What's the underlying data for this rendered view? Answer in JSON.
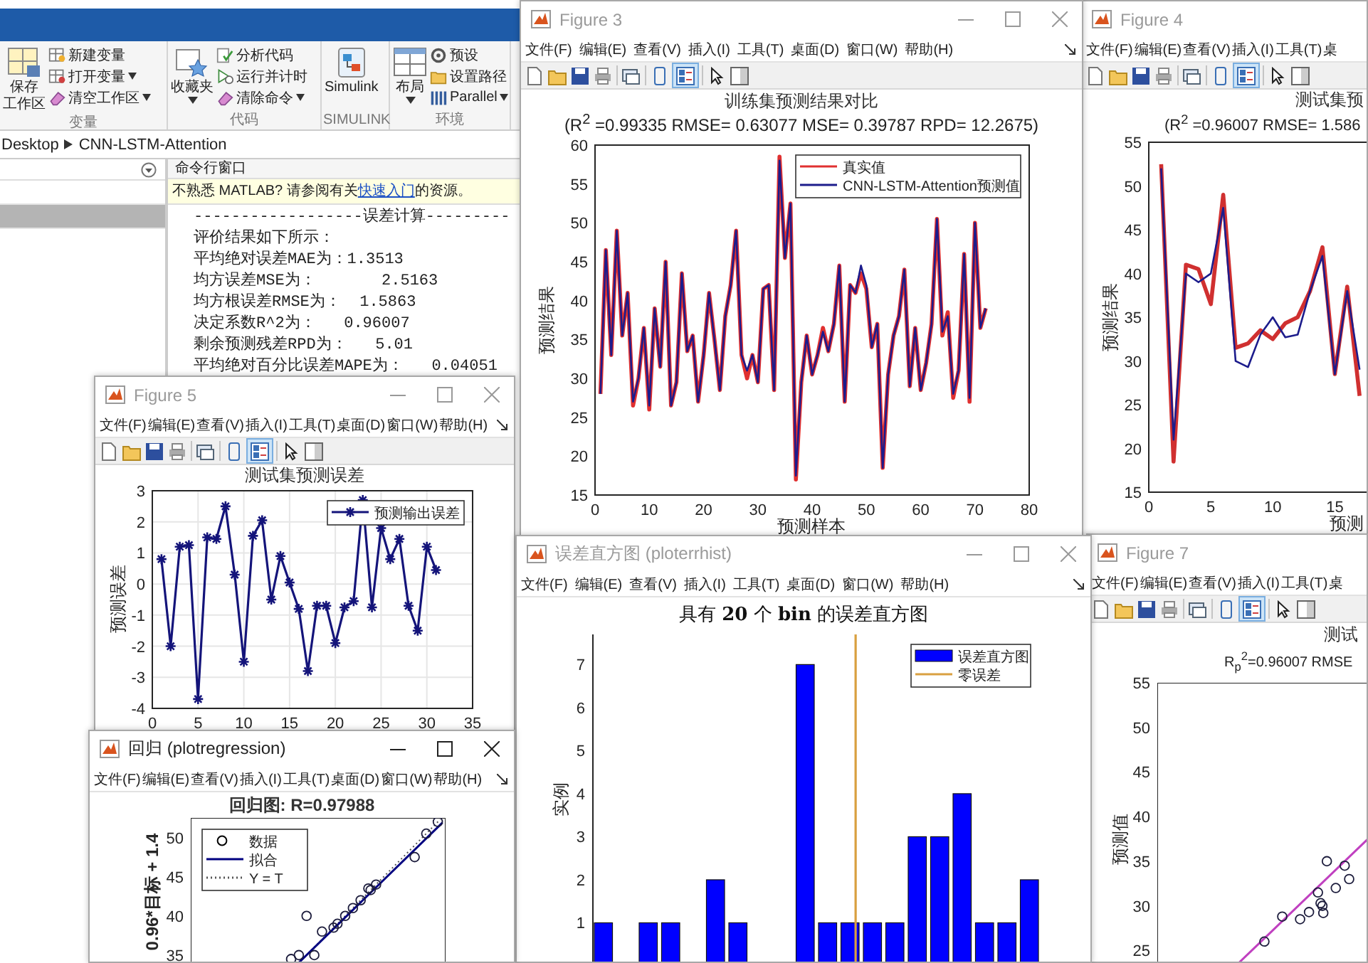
{
  "matlab": {
    "toolstrip": [
      {
        "label": "变量",
        "big": {
          "label_lines": [
            "保存",
            "工作区"
          ],
          "dropdown": false
        },
        "small": [
          {
            "label": "新建变量",
            "dropdown": false
          },
          {
            "label": "打开变量",
            "dropdown": true
          },
          {
            "label": "清空工作区",
            "dropdown": true
          }
        ]
      },
      {
        "label": "代码",
        "big": {
          "label_lines": [
            "收藏夹"
          ],
          "dropdown": true
        },
        "small": [
          {
            "label": "分析代码",
            "dropdown": false
          },
          {
            "label": "运行并计时",
            "dropdown": false
          },
          {
            "label": "清除命令",
            "dropdown": true
          }
        ]
      },
      {
        "label": "SIMULINK",
        "big": {
          "label_lines": [
            "Simulink"
          ],
          "dropdown": false
        }
      },
      {
        "label": "环境",
        "big": {
          "label_lines": [
            "布局"
          ],
          "dropdown": true
        },
        "small": [
          {
            "label": "预设",
            "dropdown": false
          },
          {
            "label": "设置路径",
            "dropdown": false
          },
          {
            "label": "Parallel",
            "dropdown": true
          }
        ]
      }
    ],
    "breadcrumb": [
      "Desktop",
      "CNN-LSTM-Attention"
    ],
    "folder_panel": {
      "rows": [
        {
          "selected": false
        },
        {
          "selected": true
        }
      ]
    },
    "command_window": {
      "title": "命令行窗口",
      "notice": {
        "before": "不熟悉 MATLAB? 请参阅有关",
        "link": "快速入门",
        "after": "的资源。"
      },
      "lines": [
        "------------------误差计算---------",
        "评价结果如下所示：",
        "平均绝对误差MAE为：1.3513",
        "均方误差MSE为：       2.5163",
        "均方根误差RMSE为：  1.5863",
        "决定系数R^2为：   0.96007",
        "剩余预测残差RPD为：   5.01",
        "平均绝对百分比误差MAPE为：   0.04051"
      ]
    }
  },
  "figures": [
    {
      "title": "Figure 3",
      "active": false,
      "menu": [
        "文件(F)",
        "编辑(E)",
        "查看(V)",
        "插入(I)",
        "工具(T)",
        "桌面(D)",
        "窗口(W)",
        "帮助(H)"
      ],
      "toolbar": {
        "plot_tools_on": true
      },
      "bold_title": false,
      "subtitle": "(R$^{2}$ =0.99335 RMSE= 0.63077 MSE= 0.39787 RPD= 12.2675)",
      "chart_data": {
        "type": "line",
        "title": "训练集预测结果对比",
        "xlabel": "预测样本",
        "ylabel": "预测结果",
        "legend": "upper right",
        "x": [
          1,
          2,
          3,
          4,
          5,
          6,
          7,
          8,
          9,
          10,
          11,
          12,
          13,
          14,
          15,
          16,
          17,
          18,
          19,
          20,
          21,
          22,
          23,
          24,
          25,
          26,
          27,
          28,
          29,
          30,
          31,
          32,
          33,
          34,
          35,
          36,
          37,
          38,
          39,
          40,
          41,
          42,
          43,
          44,
          45,
          46,
          47,
          48,
          49,
          50,
          51,
          52,
          53,
          54,
          55,
          56,
          57,
          58,
          59,
          60,
          61,
          62,
          63,
          64,
          65,
          66,
          67,
          68,
          69,
          70,
          71,
          72
        ],
        "series": [
          {
            "name": "真实值",
            "color": "#e03030",
            "values": [
              28,
              46.5,
              33,
              49,
              35.5,
              41,
              26.5,
              30,
              36.5,
              26,
              39,
              31.5,
              45,
              26.5,
              29.5,
              43.5,
              33.5,
              35.5,
              27,
              33,
              41,
              35,
              28.5,
              38,
              42,
              49,
              33,
              30,
              33,
              29.5,
              41.5,
              42,
              28.5,
              58.5,
              45.5,
              52.5,
              17,
              29.5,
              35.5,
              30.5,
              33,
              36.5,
              33.5,
              37,
              44.5,
              27,
              42,
              41,
              43.5,
              41.5,
              34,
              37,
              18.5,
              30.5,
              35.5,
              38,
              44,
              29,
              36.5,
              28.5,
              32,
              37,
              50.5,
              35.5,
              38.5,
              27.5,
              31,
              46,
              27,
              50,
              36.5,
              39
            ]
          },
          {
            "name": "CNN-LSTM-Attention预测值",
            "color": "#1c1c8c",
            "values": [
              28,
              46.5,
              33,
              49,
              35.5,
              41,
              27,
              30,
              36.5,
              26.5,
              39,
              31.5,
              45,
              26.5,
              29.5,
              43.5,
              33.5,
              35.5,
              27,
              33,
              41,
              35,
              28.5,
              38,
              42,
              49,
              33,
              31,
              33,
              29.5,
              41.5,
              42,
              28.5,
              58,
              45.5,
              52.5,
              17.5,
              29.5,
              35.5,
              30.5,
              33,
              36,
              33.5,
              37,
              44.5,
              27,
              42,
              41,
              44.5,
              42,
              34,
              37,
              18.5,
              30.5,
              35.5,
              38,
              44,
              29,
              36.5,
              28.5,
              32,
              37,
              50.5,
              36,
              38,
              28,
              31,
              46,
              27.5,
              50,
              36.5,
              39
            ]
          }
        ],
        "xlim": [
          0,
          80
        ],
        "ylim": [
          15,
          60
        ],
        "xticks": [
          0,
          10,
          20,
          30,
          40,
          50,
          60,
          70,
          80
        ],
        "yticks": [
          15,
          20,
          25,
          30,
          35,
          40,
          45,
          50,
          55,
          60
        ]
      }
    },
    {
      "title": "Figure 4",
      "active": false,
      "menu": [
        "文件(F)",
        "编辑(E)",
        "查看(V)",
        "插入(I)",
        "工具(T)",
        "桌"
      ],
      "toolbar": {
        "plot_tools_on": true
      },
      "bold_title": false,
      "subtitle": "(R$^{2}$ =0.96007 RMSE= 1.586",
      "chart_data": {
        "type": "line",
        "title": "测试集预",
        "xlabel": "预测",
        "ylabel": "预测结果",
        "x": [
          1,
          2,
          3,
          4,
          5,
          6,
          7,
          8,
          9,
          10,
          11,
          12,
          13,
          14,
          15,
          16,
          17
        ],
        "series": [
          {
            "color": "#d03030",
            "values": [
              52.5,
              18.5,
              41,
              40.5,
              36.5,
              49,
              31.5,
              32,
              33.5,
              32.5,
              34.3,
              35,
              38,
              43,
              28.5,
              38.5,
              26
            ]
          },
          {
            "color": "#1c1c8c",
            "values": [
              52,
              21,
              40,
              39,
              40,
              47.5,
              30,
              29.3,
              33,
              35,
              32.7,
              33,
              38,
              42,
              28.5,
              38,
              29
            ]
          }
        ],
        "xlim": [
          0,
          35
        ],
        "ylim": [
          15,
          55
        ],
        "xticks": [
          0,
          5,
          10,
          15
        ],
        "yticks": [
          15,
          20,
          25,
          30,
          35,
          40,
          45,
          50,
          55
        ]
      }
    },
    {
      "title": "Figure 5",
      "active": false,
      "menu": [
        "文件(F)",
        "编辑(E)",
        "查看(V)",
        "插入(I)",
        "工具(T)",
        "桌面(D)",
        "窗口(W)",
        "帮助(H)"
      ],
      "toolbar": {
        "plot_tools_on": true
      },
      "bold_title": false,
      "chart_data": {
        "type": "line",
        "title": "测试集预测误差",
        "ylabel": "预测误差",
        "legend": "upper right",
        "grid": true,
        "x": [
          1,
          2,
          3,
          4,
          5,
          6,
          7,
          8,
          9,
          10,
          11,
          12,
          13,
          14,
          15,
          16,
          17,
          18,
          19,
          20,
          21,
          22,
          23,
          24,
          25,
          26,
          27,
          28,
          29,
          30,
          31
        ],
        "series": [
          {
            "name": "预测输出误差",
            "color": "#14147a",
            "marker": "cross",
            "values": [
              0.8,
              -2,
              1.2,
              1.25,
              -3.7,
              1.5,
              1.45,
              2.5,
              0.3,
              -2.5,
              1.55,
              2.05,
              -0.5,
              0.9,
              0.05,
              -0.8,
              -2.8,
              -0.7,
              -0.7,
              -1.9,
              -0.75,
              -0.55,
              2.7,
              -0.75,
              1.8,
              0.8,
              1.45,
              -0.7,
              -1.5,
              1.2,
              0.45
            ]
          }
        ],
        "xlim": [
          0,
          35
        ],
        "ylim": [
          -4,
          3
        ],
        "xticks": [
          0,
          5,
          10,
          15,
          20,
          25,
          30,
          35
        ],
        "yticks": [
          -4,
          -3,
          -2,
          -1,
          0,
          1,
          2,
          3
        ]
      }
    },
    {
      "title": "误差直方图 (ploterrhist)",
      "active": false,
      "menu": [
        "文件(F)",
        "编辑(E)",
        "查看(V)",
        "插入(I)",
        "工具(T)",
        "桌面(D)",
        "窗口(W)",
        "帮助(H)"
      ],
      "bold_title": false,
      "chart_picture": {
        "title": "具有 **20** 个 **bin** 的误差直方图",
        "ylabel": "实例",
        "yticks": [
          "7",
          "6",
          "5",
          "4",
          "3",
          "2",
          "1"
        ],
        "legend": [
          {
            "label": "误差直方图",
            "kind": "patch"
          },
          {
            "label": "零误差",
            "kind": "line"
          }
        ]
      }
    },
    {
      "title": "Figure 7",
      "active": false,
      "menu": [
        "文件(F)",
        "编辑(E)",
        "查看(V)",
        "插入(I)",
        "工具(T)",
        "桌"
      ],
      "toolbar": {
        "plot_tools_on": true
      },
      "bold_title": false,
      "subtitle": "R$_{p}$$^{2}$=0.96007 RMSE",
      "chart_picture": {
        "title": "测试",
        "ylabel": "预测值",
        "yticks": [
          "55",
          "50",
          "45",
          "40",
          "35",
          "30",
          "25"
        ]
      }
    },
    {
      "title": "回归 (plotregression)",
      "active": true,
      "menu": [
        "文件(F)",
        "编辑(E)",
        "查看(V)",
        "插入(I)",
        "工具(T)",
        "桌面(D)",
        "窗口(W)",
        "帮助(H)"
      ],
      "bold_title": true,
      "chart_picture": {
        "title": "回归图: R=0.97988",
        "ylabel": "0.96*目标 + 1.4",
        "yticks": [
          "50",
          "45",
          "40",
          "35"
        ],
        "legend": [
          {
            "label": "数据",
            "kind": "circle"
          },
          {
            "label": "拟合",
            "kind": "line"
          },
          {
            "label": "Y = T",
            "kind": "dotted"
          }
        ]
      }
    }
  ]
}
